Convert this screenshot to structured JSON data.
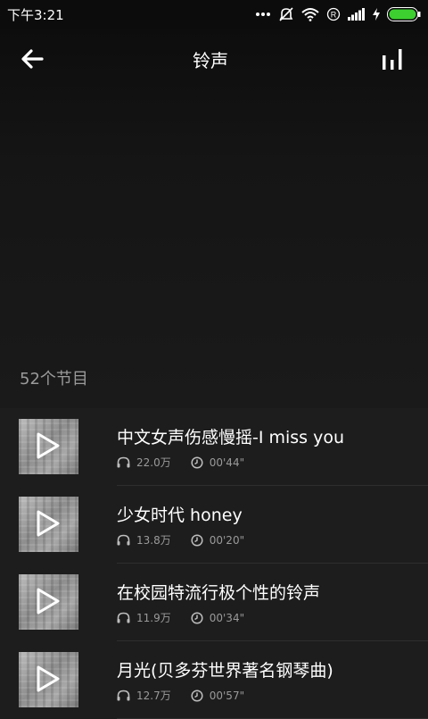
{
  "status_bar": {
    "time": "下午3:21",
    "icons": [
      "more-dots-icon",
      "mute-icon",
      "wifi-icon",
      "roaming-r-icon",
      "signal-icon",
      "charging-icon",
      "battery-icon"
    ]
  },
  "header": {
    "title": "铃声",
    "back_icon": "arrow-left-icon",
    "chart_icon": "bar-chart-icon"
  },
  "program_count": "52个节目",
  "items": [
    {
      "title": "中文女声伤感慢摇-I miss you",
      "plays": "22.0万",
      "duration": "00'44\""
    },
    {
      "title": "少女时代 honey",
      "plays": "13.8万",
      "duration": "00'20\""
    },
    {
      "title": "在校园特流行极个性的铃声",
      "plays": "11.9万",
      "duration": "00'34\""
    },
    {
      "title": "月光(贝多芬世界著名钢琴曲)",
      "plays": "12.7万",
      "duration": "00'57\""
    }
  ],
  "colors": {
    "background": "#1d1d1d",
    "secondary_text": "#9a9a9a",
    "battery": "#3ccf2f"
  }
}
